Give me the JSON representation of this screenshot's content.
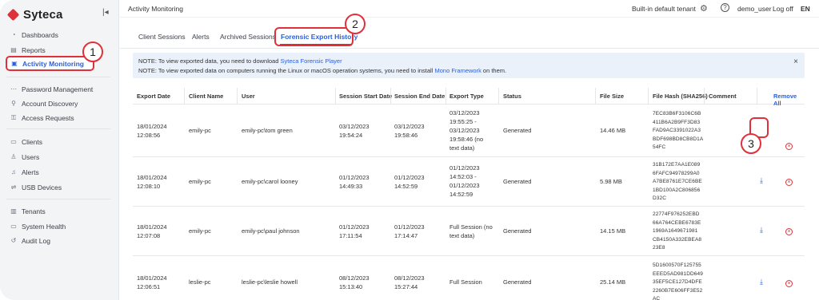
{
  "app": {
    "logo_text": "Syteca",
    "brand_color": "#e0313a",
    "accent_color": "#2b5fd9"
  },
  "sidebar": {
    "collapse_icon": "collapse-icon",
    "items": [
      {
        "label": "Dashboards",
        "icon": "dashboard-icon"
      },
      {
        "label": "Reports",
        "icon": "reports-icon"
      },
      {
        "label": "Activity Monitoring",
        "icon": "monitor-icon"
      },
      {
        "label": "Password Management",
        "icon": "password-icon"
      },
      {
        "label": "Account Discovery",
        "icon": "discovery-icon"
      },
      {
        "label": "Access Requests",
        "icon": "access-icon"
      },
      {
        "label": "Clients",
        "icon": "clients-icon"
      },
      {
        "label": "Users",
        "icon": "users-icon"
      },
      {
        "label": "Alerts",
        "icon": "bell-icon"
      },
      {
        "label": "USB Devices",
        "icon": "usb-icon"
      },
      {
        "label": "Tenants",
        "icon": "tenants-icon"
      },
      {
        "label": "System Health",
        "icon": "health-icon"
      },
      {
        "label": "Audit Log",
        "icon": "audit-icon"
      }
    ]
  },
  "topbar": {
    "title": "Activity Monitoring",
    "tenant": "Built-in default tenant",
    "user": "demo_user",
    "logoff": "Log off",
    "lang": "EN"
  },
  "tabs": [
    {
      "label": "Client Sessions"
    },
    {
      "label": "Alerts"
    },
    {
      "label": "Archived Sessions"
    },
    {
      "label": "Forensic Export History"
    }
  ],
  "callouts": [
    "1",
    "2",
    "3"
  ],
  "note": {
    "line1_prefix": "NOTE: To view exported data, you need to download ",
    "line1_link": "Syteca Forensic Player",
    "line2_prefix": "NOTE: To view exported data on computers running the Linux or macOS operation systems, you need to install ",
    "line2_link": "Mono Framework",
    "line2_suffix": " on them.",
    "close": "×"
  },
  "table": {
    "columns": [
      "Export Date",
      "Client Name",
      "User",
      "Session Start Date",
      "Session End Date",
      "Export Type",
      "Status",
      "File Size",
      "File Hash (SHA256)",
      "Comment"
    ],
    "remove_all": "Remove All",
    "rows": [
      {
        "export_date": "18/01/2024\n12:08:56",
        "client": "emily-pc",
        "user": "emily-pc\\tom green",
        "start": "03/12/2023\n19:54:24",
        "end": "03/12/2023\n19:58:46",
        "export_type": "03/12/2023\n19:55:25 -\n03/12/2023\n19:58:46 (no\ntext data)",
        "status": "Generated",
        "size": "14.46 MB",
        "hash": "7EC83B6F3106C6B\n411B6A2B9FF3D83\nFAD9AC3391022A3\nBDF698BD8CB8D1A\n54FC",
        "comment": ""
      },
      {
        "export_date": "18/01/2024\n12:08:10",
        "client": "emily-pc",
        "user": "emily-pc\\carol looney",
        "start": "01/12/2023\n14:49:33",
        "end": "01/12/2023\n14:52:59",
        "export_type": "01/12/2023\n14:52:03 -\n01/12/2023\n14:52:59",
        "status": "Generated",
        "size": "5.98 MB",
        "hash": "31B172E7AA1E089\n6FAFC94978299A0\nA7BE8761E7CE6BE\n1BD100A2C806856\nD32C",
        "comment": ""
      },
      {
        "export_date": "18/01/2024\n12:07:08",
        "client": "emily-pc",
        "user": "emily-pc\\paul johnson",
        "start": "01/12/2023\n17:11:54",
        "end": "01/12/2023\n17:14:47",
        "export_type": "Full Session (no\ntext data)",
        "status": "Generated",
        "size": "14.15 MB",
        "hash": "22774F976252EBD\n66A764CEBE6783E\n1969A1649671981\nCB4150A332EBEA8\n23E8",
        "comment": ""
      },
      {
        "export_date": "18/01/2024\n12:06:51",
        "client": "leslie-pc",
        "user": "leslie-pc\\leslie howell",
        "start": "08/12/2023\n15:13:40",
        "end": "08/12/2023\n15:27:44",
        "export_type": "Full Session",
        "status": "Generated",
        "size": "25.14 MB",
        "hash": "5D1600570F125755\nEEED5AD981DD649\n35EF5CE127D4DFE\n2260B7E606FF3E52\nAC",
        "comment": ""
      }
    ]
  }
}
